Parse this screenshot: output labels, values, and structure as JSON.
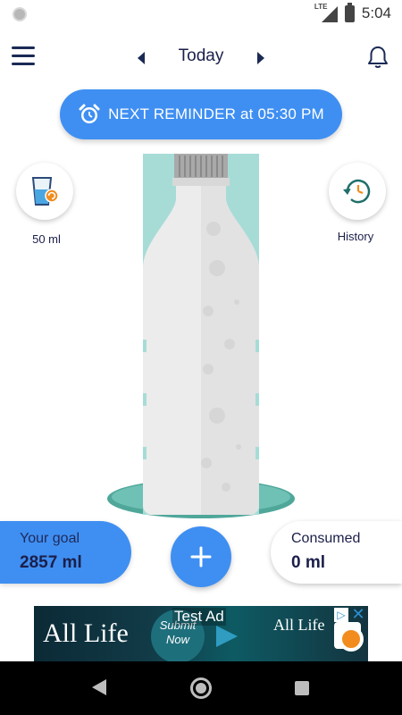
{
  "status_bar": {
    "network_label": "LTE",
    "time": "5:04"
  },
  "toolbar": {
    "menu_icon": "hamburger-menu-icon",
    "date_label": "Today",
    "prev_icon": "chevron-left-icon",
    "next_icon": "chevron-right-icon",
    "notification_icon": "bell-icon"
  },
  "reminder": {
    "icon": "alarm-clock-icon",
    "text": "NEXT REMINDER at 05:30 PM"
  },
  "cup_selector": {
    "icon": "water-glass-icon",
    "label": "50 ml"
  },
  "history": {
    "icon": "history-clock-icon",
    "label": "History"
  },
  "bottle": {
    "fill_fraction": 0.0
  },
  "goal": {
    "title": "Your goal",
    "value": "2857 ml"
  },
  "consumed": {
    "title": "Consumed",
    "value": "0 ml"
  },
  "add_button": {
    "icon": "plus-icon"
  },
  "ad": {
    "label": "Test Ad",
    "brand": "All Life",
    "cta": "Submit Now",
    "logo_text": "All Life",
    "adchoices_icon": "adchoices-icon",
    "close_icon": "close-icon"
  },
  "colors": {
    "accent": "#3f8ff2",
    "text_dark": "#1b1f4a",
    "teal": "#a7dcd6",
    "teal_dark": "#4fa79a"
  }
}
